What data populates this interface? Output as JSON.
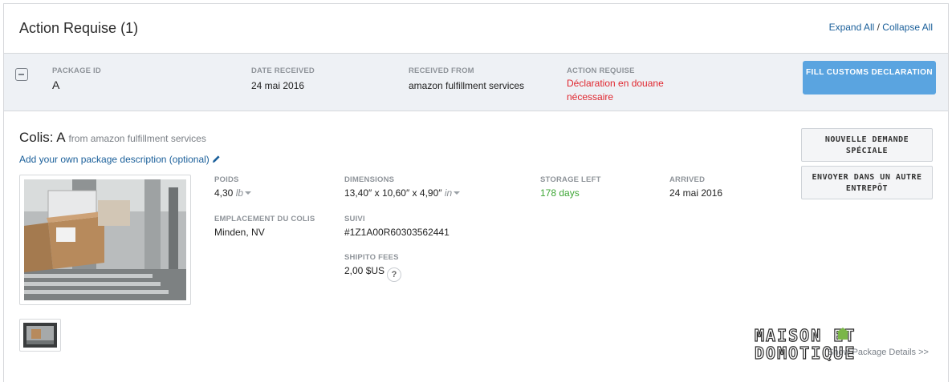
{
  "header": {
    "title": "Action Requise (1)",
    "expand_all": "Expand All",
    "separator": " / ",
    "collapse_all": "Collapse All"
  },
  "summary": {
    "package_id_label": "PACKAGE ID",
    "package_id": "A",
    "date_received_label": "DATE RECEIVED",
    "date_received": "24 mai 2016",
    "received_from_label": "RECEIVED FROM",
    "received_from": "amazon fulfillment services",
    "action_label": "ACTION REQUISE",
    "action_value": "Déclaration en douane nécessaire",
    "fill_button": "FILL CUSTOMS DECLARATION"
  },
  "detail": {
    "title_prefix": "Colis: A",
    "title_from": "from amazon fulfillment services",
    "description_link": "Add your own package description (optional)",
    "weight_label": "POIDS",
    "weight_value": "4,30",
    "weight_unit": "lb",
    "dimensions_label": "DIMENSIONS",
    "dimensions_value": "13,40″ x 10,60″ x 4,90″",
    "dimensions_unit": "in",
    "storage_label": "STORAGE LEFT",
    "storage_value": "178 days",
    "arrived_label": "ARRIVED",
    "arrived_value": "24 mai 2016",
    "location_label": "EMPLACEMENT DU COLIS",
    "location_value": "Minden, NV",
    "tracking_label": "SUIVI",
    "tracking_value": "#1Z1A00R60303562441",
    "fees_label": "SHIPITO FEES",
    "fees_value": "2,00 $US",
    "help_glyph": "?"
  },
  "actions": {
    "special_request": "NOUVELLE DEMANDE SPÉCIALE",
    "other_warehouse": "ENVOYER DANS UN AUTRE ENTREPÔT"
  },
  "footer": {
    "more_details": "Show Package Details >>"
  },
  "watermark": {
    "line1": "MAISON ET",
    "line2": "DOMOTIQUE"
  },
  "colors": {
    "primary_button": "#5aa4e0",
    "link": "#1a5f9a",
    "alert": "#e0262e",
    "success": "#3ea635",
    "band": "#eef1f5"
  }
}
